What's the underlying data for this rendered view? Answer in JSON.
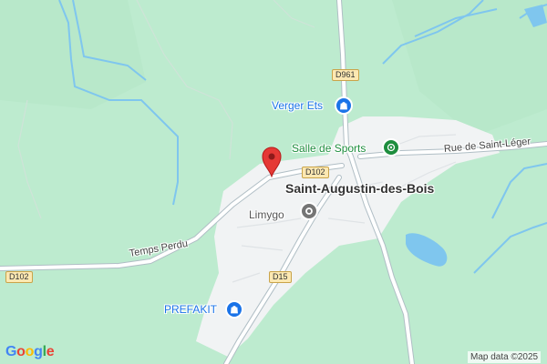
{
  "map": {
    "town_name": "Saint-Augustin-des-Bois",
    "roads": {
      "temps_perdu": "Temps Perdu",
      "rue_saint_leger": "Rue de Saint-Léger"
    },
    "shields": {
      "d961": "D961",
      "d102_top": "D102",
      "d102_left": "D102",
      "d15": "D15"
    },
    "pois": {
      "verger": "Verger Ets",
      "salle": "Salle de Sports",
      "limygo": "Limygo",
      "prefakit": "PREFAKIT"
    },
    "colors": {
      "background": "#bdebcf",
      "urban": "#f1f3f4",
      "road": "#ffffff",
      "road_casing": "#b0bec5",
      "water": "#7fc6ee",
      "pin": "#e53935",
      "shop_poi": "#1a73e8",
      "sport_poi": "#1e8e3e",
      "business_poi": "#757575"
    },
    "icons": {
      "pin": "location-pin-icon",
      "verger": "shopping-bag-icon",
      "salle": "sports-icon",
      "limygo": "business-icon",
      "prefakit": "shopping-bag-icon"
    }
  },
  "branding": {
    "logo": "Google",
    "attribution": "Map data ©2025"
  }
}
